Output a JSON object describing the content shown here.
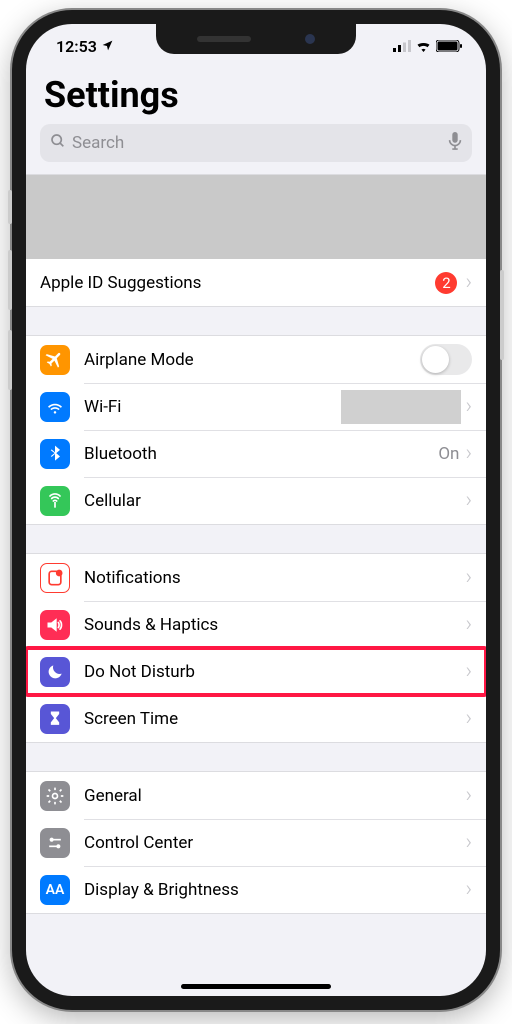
{
  "status": {
    "time": "12:53"
  },
  "title": "Settings",
  "search": {
    "placeholder": "Search"
  },
  "apple_id_row": {
    "label": "Apple ID Suggestions",
    "badge": "2"
  },
  "group1": {
    "airplane": {
      "label": "Airplane Mode"
    },
    "wifi": {
      "label": "Wi-Fi"
    },
    "bluetooth": {
      "label": "Bluetooth",
      "value": "On"
    },
    "cellular": {
      "label": "Cellular"
    }
  },
  "group2": {
    "notifications": {
      "label": "Notifications"
    },
    "sounds": {
      "label": "Sounds & Haptics"
    },
    "dnd": {
      "label": "Do Not Disturb"
    },
    "screentime": {
      "label": "Screen Time"
    }
  },
  "group3": {
    "general": {
      "label": "General"
    },
    "controlcenter": {
      "label": "Control Center"
    },
    "display": {
      "label": "Display & Brightness"
    }
  },
  "icon_colors": {
    "airplane": "#ff9500",
    "wifi": "#007aff",
    "bluetooth": "#007aff",
    "cellular": "#34c759",
    "notifications": "#ff3b30",
    "sounds": "#ff2d55",
    "dnd": "#5856d6",
    "screentime": "#5856d6",
    "general": "#8e8e93",
    "controlcenter": "#8e8e93",
    "display": "#007aff"
  }
}
